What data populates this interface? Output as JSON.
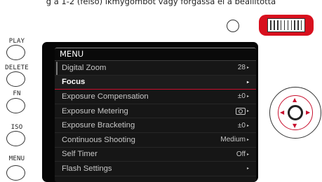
{
  "caption": "g a 1-2 (felső) ikmygombot vagy forgassa el a beállította",
  "side_buttons": [
    {
      "label": "PLAY"
    },
    {
      "label": "DELETE"
    },
    {
      "label": "FN"
    },
    {
      "label": "ISO"
    },
    {
      "label": "MENU"
    }
  ],
  "menu": {
    "title": "MENU",
    "items": [
      {
        "label": "Digital Zoom",
        "value": "28"
      },
      {
        "label": "Focus",
        "value": ""
      },
      {
        "label": "Exposure Compensation",
        "value": "±0"
      },
      {
        "label": "Exposure Metering",
        "value": ""
      },
      {
        "label": "Exposure Bracketing",
        "value": "±0"
      },
      {
        "label": "Continuous Shooting",
        "value": "Medium"
      },
      {
        "label": "Self Timer",
        "value": "Off"
      },
      {
        "label": "Flash Settings",
        "value": ""
      }
    ],
    "selected_index": 1
  },
  "icons": {
    "arrow": "▸",
    "up": "▲",
    "down": "▼",
    "left": "◀",
    "right": "▶"
  },
  "colors": {
    "accent": "#c8102e",
    "wheel": "#d8101e",
    "screen_bg": "#060606"
  }
}
